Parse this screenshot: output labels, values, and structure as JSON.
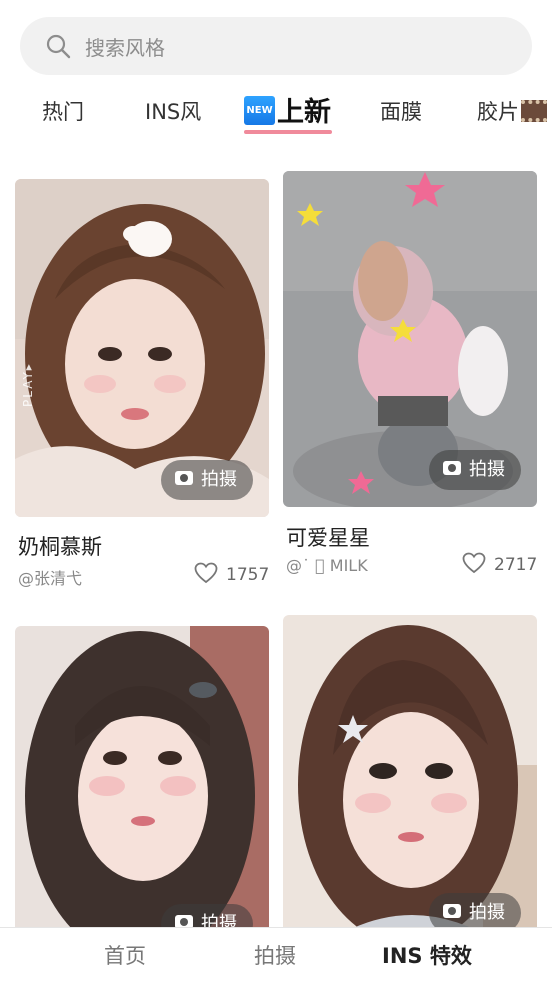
{
  "search": {
    "placeholder": "搜索风格"
  },
  "tabs": [
    {
      "label": "热门"
    },
    {
      "label": "INS风"
    },
    {
      "label": "上新",
      "badge": "NEW",
      "active": true
    },
    {
      "label": "面膜"
    },
    {
      "label": "胶片"
    }
  ],
  "cards": [
    {
      "title": "奶桐慕斯",
      "author": "@张清弋",
      "likes": "1757",
      "button": "拍摄",
      "watermark": "PLAY▸"
    },
    {
      "title": "可爱星星",
      "author": "@˙ ᪲ MILK",
      "likes": "2717",
      "button": "拍摄"
    },
    {
      "title": "",
      "author": "",
      "likes": "",
      "button": "拍摄"
    },
    {
      "title": "",
      "author": "",
      "likes": "",
      "button": "拍摄"
    }
  ],
  "bottom_nav": [
    {
      "label": "首页"
    },
    {
      "label": "拍摄"
    },
    {
      "label": "INS 特效",
      "active": true
    }
  ],
  "colors": {
    "accent_underline": "#f08a9b",
    "search_bg": "#f1f1f1"
  }
}
